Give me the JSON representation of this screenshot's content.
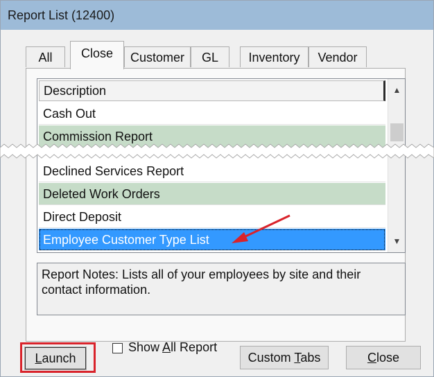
{
  "window": {
    "title": "Report List (12400)"
  },
  "tabs": [
    {
      "label": "All",
      "active": false
    },
    {
      "label": "Close",
      "active": true
    },
    {
      "label": "Customer",
      "active": false
    },
    {
      "label": "GL",
      "active": false
    },
    {
      "label": "Inventory",
      "active": false
    },
    {
      "label": "Vendor",
      "active": false
    }
  ],
  "list": {
    "header": "Description",
    "rows_top": [
      {
        "label": "Cash Out",
        "style": "white"
      },
      {
        "label": "Commission Report",
        "style": "green"
      }
    ],
    "rows_bottom": [
      {
        "label": "Declined Services Report",
        "style": "white"
      },
      {
        "label": "Deleted Work Orders",
        "style": "green"
      },
      {
        "label": "Direct Deposit",
        "style": "white"
      },
      {
        "label": "Employee Customer Type List",
        "style": "selected"
      }
    ],
    "scroll_up": "▲",
    "scroll_down": "▼"
  },
  "notes": {
    "text": "Report Notes:  Lists all of your employees by site and their contact information."
  },
  "footer": {
    "launch_prefix": "",
    "launch_underline": "L",
    "launch_rest": "aunch",
    "show_all_prefix": "Show ",
    "show_all_underline": "A",
    "show_all_rest": "ll Report",
    "show_all_checked": false,
    "custom_prefix": "Custom ",
    "custom_underline": "T",
    "custom_rest": "abs",
    "close_prefix": "",
    "close_underline": "C",
    "close_rest": "lose"
  },
  "colors": {
    "title_bar": "#9dbbd8",
    "row_green": "#c6dcc8",
    "selection": "#3399ff",
    "highlight_red": "#d9232b"
  }
}
